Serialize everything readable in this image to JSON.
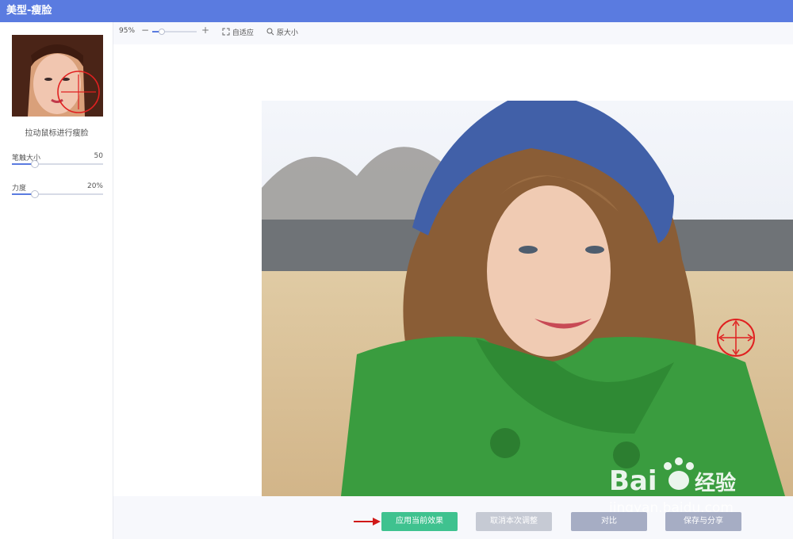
{
  "window": {
    "title": "美型-瘦脸"
  },
  "sidebar": {
    "hint": "拉动鼠标进行瘦脸",
    "brush": {
      "label": "笔触大小",
      "value": "50",
      "level": 0.25
    },
    "strength": {
      "label": "力度",
      "value": "20%",
      "level": 0.25
    }
  },
  "toolbar": {
    "zoom": "95%",
    "zoom_level": 0.22,
    "fit_label": "自适应",
    "original_label": "原大小"
  },
  "actions": {
    "apply": "应用当前效果",
    "cancel": "取消本次调整",
    "compare": "对比",
    "save": "保存与分享"
  },
  "watermark": {
    "brand": "Bai",
    "brand2": "经验",
    "url": "jingyan.baidu.com"
  },
  "colors": {
    "titlebar": "#5a7be0",
    "apply": "#3fc28f",
    "cursor": "#e02020"
  }
}
